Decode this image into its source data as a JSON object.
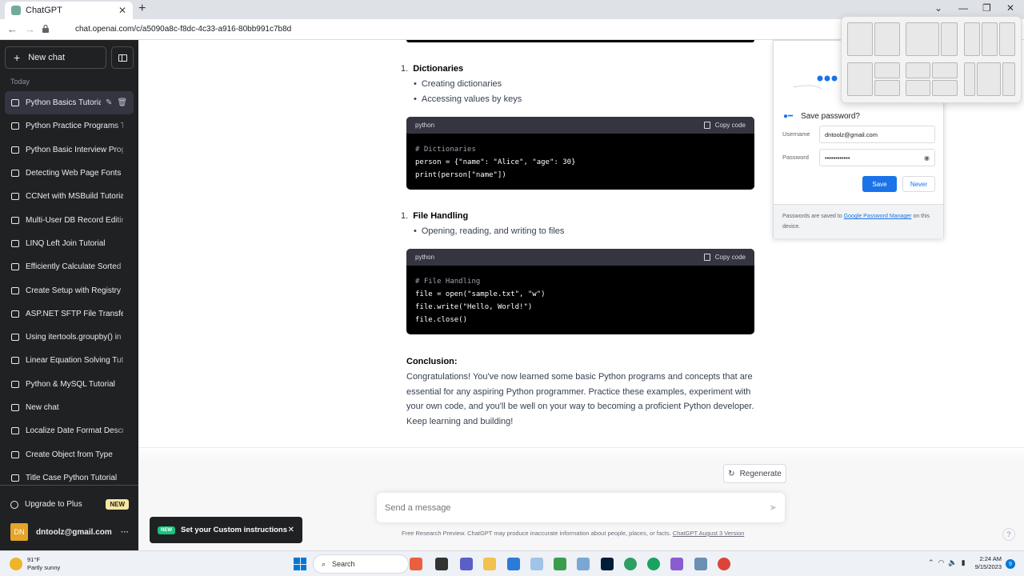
{
  "browser": {
    "tab_title": "ChatGPT",
    "tab_close": "✕",
    "new_tab": "+",
    "url": "chat.openai.com/c/a5090a8c-f8dc-4c33-a916-80bb991c7b8d",
    "back": "←",
    "forward": "→",
    "reload": "↻",
    "win_minimize": "—",
    "win_maximize": "❐",
    "win_close": "✕",
    "win_chevron": "⌄"
  },
  "sidebar": {
    "new_chat_label": "New chat",
    "section_label": "Today",
    "items": [
      {
        "label": "Python Basics Tutorial"
      },
      {
        "label": "Python Practice Programs Tutorial"
      },
      {
        "label": "Python Basic Interview Programs"
      },
      {
        "label": "Detecting Web Page Fonts"
      },
      {
        "label": "CCNet with MSBuild Tutorial"
      },
      {
        "label": "Multi-User DB Record Editing"
      },
      {
        "label": "LINQ Left Join Tutorial"
      },
      {
        "label": "Efficiently Calculate Sorted Sum"
      },
      {
        "label": "Create Setup with Registry"
      },
      {
        "label": "ASP.NET SFTP File Transfer"
      },
      {
        "label": "Using itertools.groupby() in Python"
      },
      {
        "label": "Linear Equation Solving Tutorial"
      },
      {
        "label": "Python & MySQL Tutorial"
      },
      {
        "label": "New chat"
      },
      {
        "label": "Localize Date Format Description"
      },
      {
        "label": "Create Object from Type"
      },
      {
        "label": "Title Case Python Tutorial"
      }
    ],
    "upgrade_label": "Upgrade to Plus",
    "upgrade_badge": "NEW",
    "user_initials": "DN",
    "user_email": "dntoolz@gmail.com",
    "user_menu": "···"
  },
  "content": {
    "section1": {
      "number": "1.",
      "title": "Dictionaries",
      "bullets": [
        "Creating dictionaries",
        "Accessing values by keys"
      ],
      "code_lang": "python",
      "copy_label": "Copy code",
      "code_lines": [
        "# Dictionaries",
        "person = {\"name\": \"Alice\", \"age\": 30}",
        "print(person[\"name\"])"
      ]
    },
    "section2": {
      "number": "1.",
      "title": "File Handling",
      "bullets": [
        "Opening, reading, and writing to files"
      ],
      "code_lang": "python",
      "copy_label": "Copy code",
      "code_lines": [
        "# File Handling",
        "file = open(\"sample.txt\", \"w\")",
        "file.write(\"Hello, World!\")",
        "file.close()"
      ]
    },
    "conclusion_heading": "Conclusion:",
    "conclusion_text": "Congratulations! You've now learned some basic Python programs and concepts that are essential for any aspiring Python programmer. Practice these examples, experiment with your own code, and you'll be well on your way to becoming a proficient Python developer. Keep learning and building!"
  },
  "composer": {
    "regenerate_label": "Regenerate",
    "placeholder": "Send a message",
    "disclaimer": "Free Research Preview. ChatGPT may produce inaccurate information about people, places, or facts.",
    "version_link": "ChatGPT August 3 Version",
    "help": "?"
  },
  "toast": {
    "badge": "NEW",
    "text": "Set your Custom instructions",
    "close": "✕"
  },
  "password_popup": {
    "title": "Save password?",
    "username_label": "Username",
    "username_value": "dntoolz@gmail.com",
    "password_label": "Password",
    "password_value": "••••••••••••",
    "save_label": "Save",
    "never_label": "Never",
    "footer_text": "Passwords are saved to",
    "footer_link": "Google Password Manager",
    "footer_suffix": "on this device."
  },
  "taskbar": {
    "temperature": "91°F",
    "weather": "Partly sunny",
    "search_label": "Search",
    "time": "2:24 AM",
    "date": "9/15/2023",
    "notifications": "9"
  },
  "colors": {
    "sidebar_bg": "#202123",
    "accent_green": "#19c37d",
    "chrome_blue": "#1a73e8"
  }
}
